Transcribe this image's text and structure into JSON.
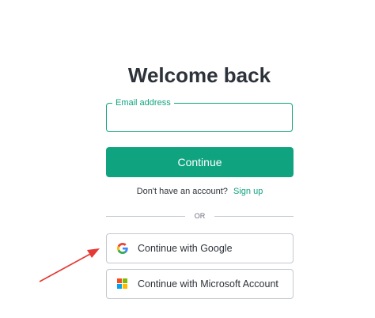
{
  "header": {
    "title": "Welcome back"
  },
  "form": {
    "email_label": "Email address",
    "email_value": "",
    "continue_label": "Continue",
    "no_account_text": "Don't have an account?",
    "signup_label": "Sign up",
    "divider_text": "OR"
  },
  "social": {
    "google_label": "Continue with Google",
    "google_icon": "google-icon",
    "microsoft_label": "Continue with Microsoft Account",
    "microsoft_icon": "microsoft-icon"
  },
  "colors": {
    "accent": "#10a37f",
    "text": "#2d333a",
    "border": "#c2c8d0",
    "annotation": "#e53935"
  }
}
